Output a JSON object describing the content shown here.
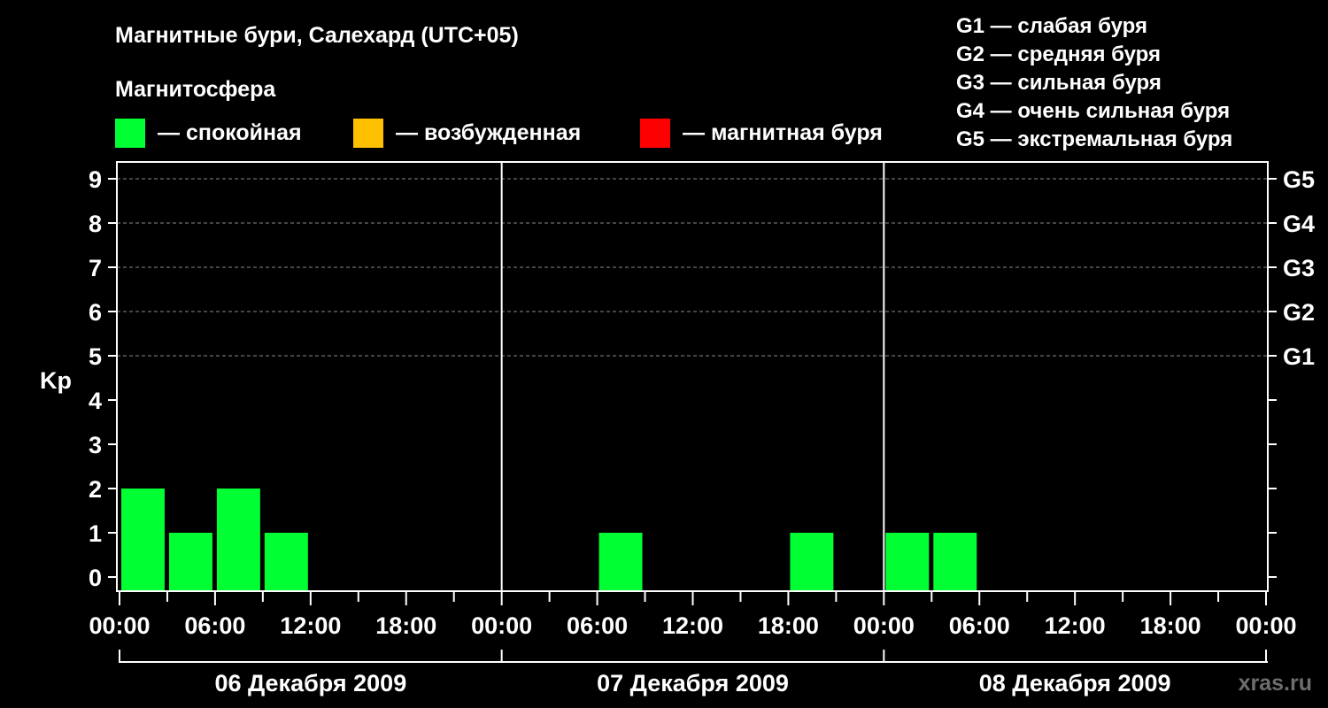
{
  "chart_data": {
    "type": "bar",
    "title": "Магнитные бури, Салехард (UTC+05)",
    "legend": {
      "title": "Магнитосфера",
      "items": [
        {
          "label": "— спокойная",
          "color": "#00ff33"
        },
        {
          "label": "— возбужденная",
          "color": "#ffc000"
        },
        {
          "label": "— магнитная буря",
          "color": "#ff0000"
        }
      ]
    },
    "storm_levels": [
      "G1 — слабая буря",
      "G2 — средняя буря",
      "G3 — сильная буря",
      "G4 — очень сильная буря",
      "G5 — экстремальная буря"
    ],
    "ylabel": "Kp",
    "ylim": [
      0,
      9
    ],
    "y_ticks": [
      "0",
      "1",
      "2",
      "3",
      "4",
      "5",
      "6",
      "7",
      "8",
      "9"
    ],
    "right_ticks": [
      {
        "kp": 5,
        "label": "G1"
      },
      {
        "kp": 6,
        "label": "G2"
      },
      {
        "kp": 7,
        "label": "G3"
      },
      {
        "kp": 8,
        "label": "G4"
      },
      {
        "kp": 9,
        "label": "G5"
      }
    ],
    "grid": true,
    "x_range_hours": [
      0,
      72
    ],
    "x_ticks": [
      "00:00",
      "06:00",
      "12:00",
      "18:00",
      "00:00",
      "06:00",
      "12:00",
      "18:00",
      "00:00",
      "06:00",
      "12:00",
      "18:00",
      "00:00"
    ],
    "days": [
      "06 Декабря 2009",
      "07 Декабря 2009",
      "08 Декабря 2009"
    ],
    "bars": [
      {
        "start_hour": 0,
        "kp": 2,
        "color": "#00ff33"
      },
      {
        "start_hour": 3,
        "kp": 1,
        "color": "#00ff33"
      },
      {
        "start_hour": 6,
        "kp": 2,
        "color": "#00ff33"
      },
      {
        "start_hour": 9,
        "kp": 1,
        "color": "#00ff33"
      },
      {
        "start_hour": 12,
        "kp": 0,
        "color": "#00ff33"
      },
      {
        "start_hour": 15,
        "kp": 0,
        "color": "#00ff33"
      },
      {
        "start_hour": 18,
        "kp": 0,
        "color": "#00ff33"
      },
      {
        "start_hour": 21,
        "kp": 0,
        "color": "#00ff33"
      },
      {
        "start_hour": 24,
        "kp": 0,
        "color": "#00ff33"
      },
      {
        "start_hour": 27,
        "kp": 0,
        "color": "#00ff33"
      },
      {
        "start_hour": 30,
        "kp": 1,
        "color": "#00ff33"
      },
      {
        "start_hour": 33,
        "kp": 0,
        "color": "#00ff33"
      },
      {
        "start_hour": 36,
        "kp": 0,
        "color": "#00ff33"
      },
      {
        "start_hour": 39,
        "kp": 0,
        "color": "#00ff33"
      },
      {
        "start_hour": 42,
        "kp": 1,
        "color": "#00ff33"
      },
      {
        "start_hour": 45,
        "kp": 0,
        "color": "#00ff33"
      },
      {
        "start_hour": 48,
        "kp": 1,
        "color": "#00ff33"
      },
      {
        "start_hour": 51,
        "kp": 1,
        "color": "#00ff33"
      }
    ]
  },
  "watermark": "xras.ru"
}
